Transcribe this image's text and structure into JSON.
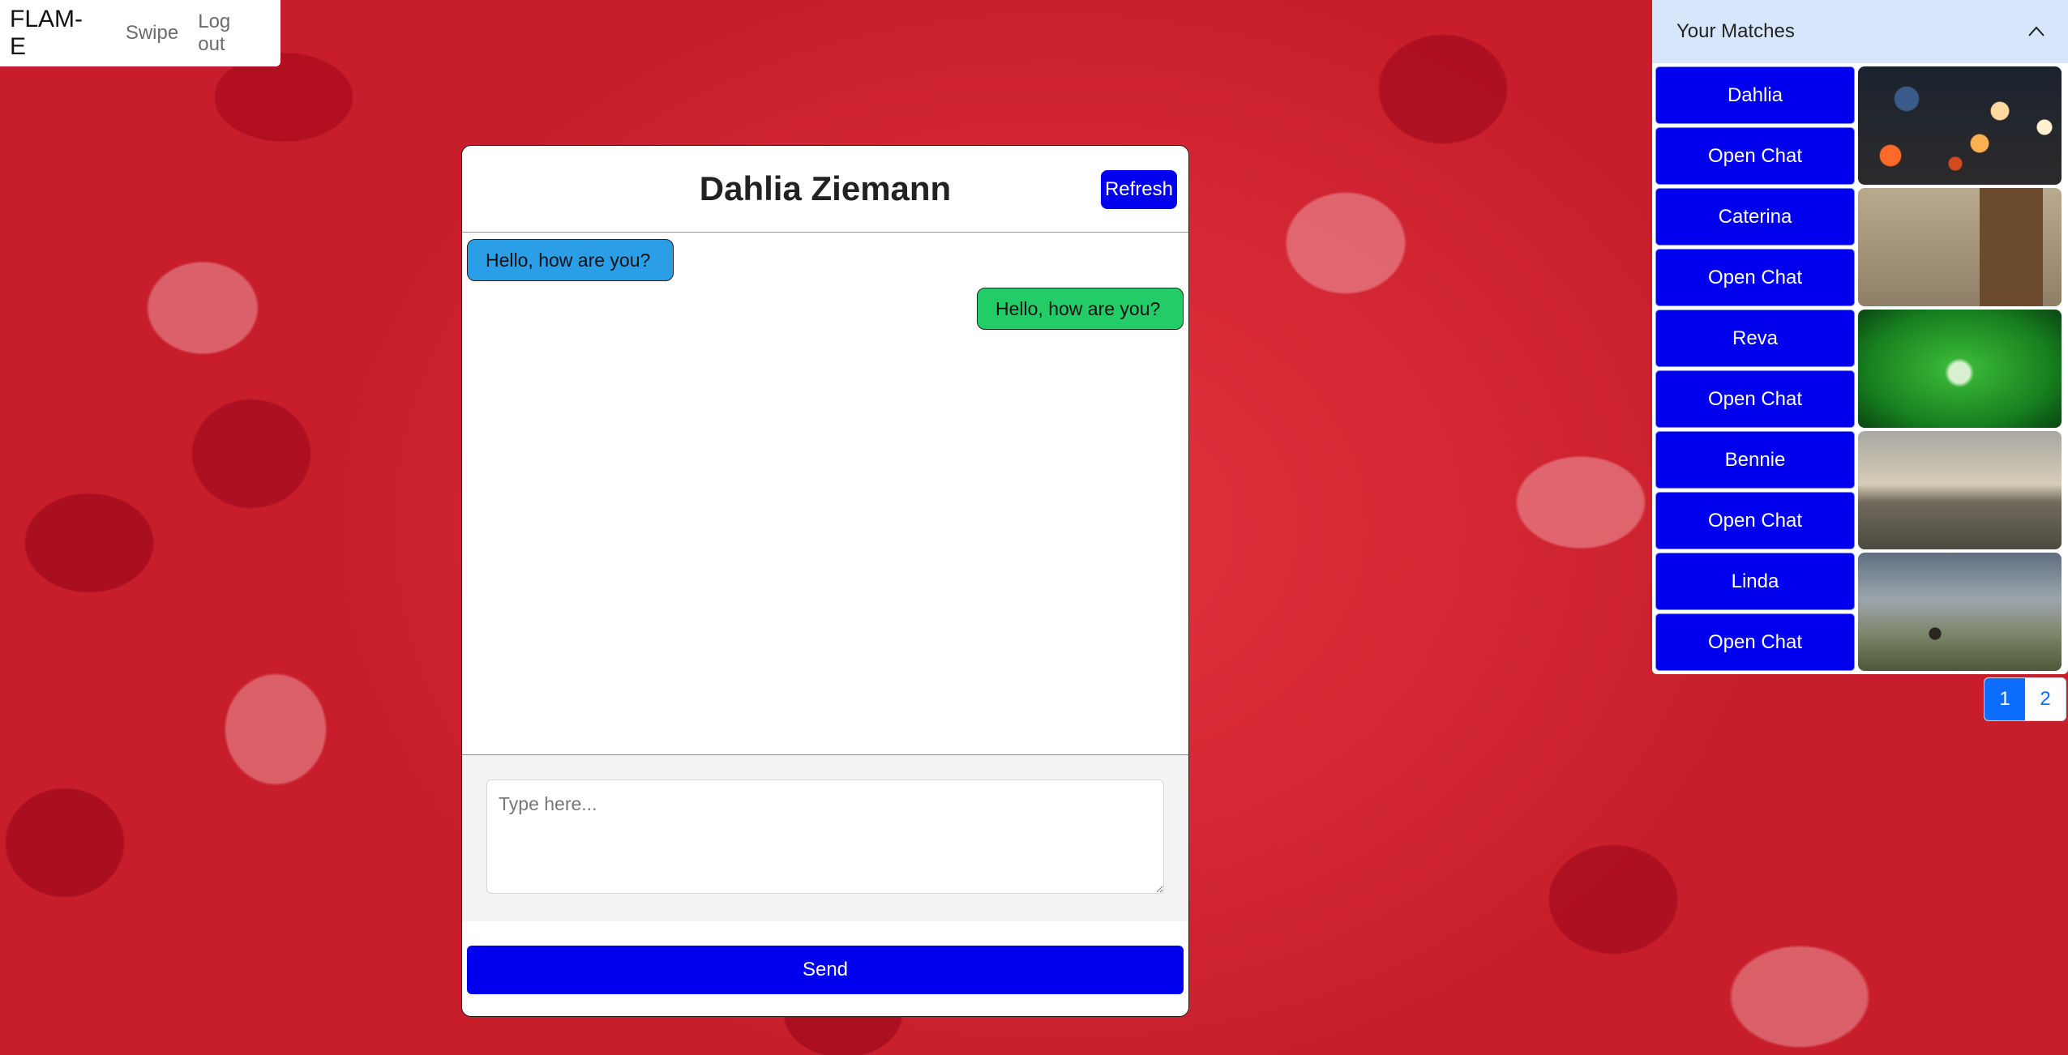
{
  "nav": {
    "brand": "FLAM-E",
    "links": [
      "Swipe",
      "Log out"
    ]
  },
  "chat": {
    "title": "Dahlia Ziemann",
    "refresh_label": "Refresh",
    "messages": [
      {
        "direction": "incoming",
        "text": "Hello, how are you?"
      },
      {
        "direction": "outgoing",
        "text": "Hello, how are you?"
      }
    ],
    "input_placeholder": "Type here...",
    "send_label": "Send"
  },
  "matches": {
    "title": "Your Matches",
    "open_chat_label": "Open Chat",
    "items": [
      {
        "name": "Dahlia",
        "open_chat": "Open Chat"
      },
      {
        "name": "Caterina",
        "open_chat": "Open Chat"
      },
      {
        "name": "Reva",
        "open_chat": "Open Chat"
      },
      {
        "name": "Bennie",
        "open_chat": "Open Chat"
      },
      {
        "name": "Linda",
        "open_chat": "Open Chat"
      }
    ],
    "pages": [
      "1",
      "2"
    ],
    "active_page": "1"
  },
  "colors": {
    "accent_button": "#0000ee",
    "incoming_bubble": "#2a9ee6",
    "outgoing_bubble": "#22cc66",
    "matches_header": "#d8e6fb",
    "pagination_active": "#0d6efd"
  },
  "icons": {
    "collapse": "chevron-up-icon",
    "resize": "resize-handle-icon"
  }
}
